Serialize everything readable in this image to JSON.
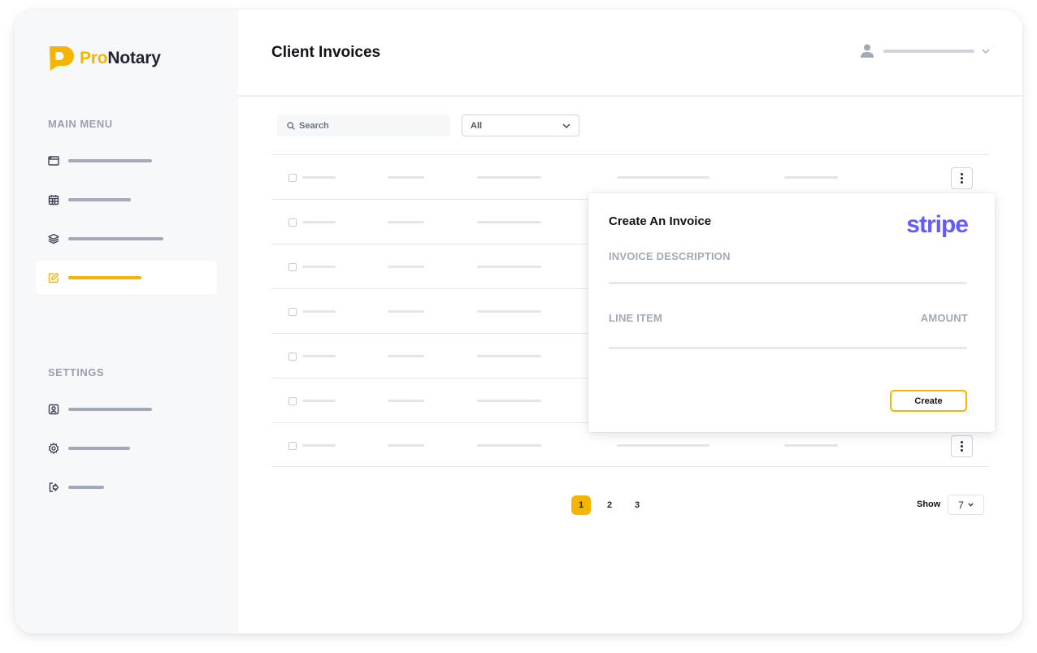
{
  "brand": {
    "name_part1": "Pro",
    "name_part2": "Notary",
    "accent_color": "#f5b400",
    "dark_color": "#1e2433"
  },
  "sidebar": {
    "main_menu_label": "MAIN MENU",
    "settings_label": "SETTINGS",
    "main_items": [
      {
        "icon": "browser-window-icon",
        "active": false
      },
      {
        "icon": "calendar-icon",
        "active": false
      },
      {
        "icon": "layers-icon",
        "active": false
      },
      {
        "icon": "edit-icon",
        "active": true
      }
    ],
    "settings_items": [
      {
        "icon": "profile-icon"
      },
      {
        "icon": "gear-icon"
      },
      {
        "icon": "logout-icon"
      }
    ]
  },
  "header": {
    "title": "Client Invoices",
    "user_icon": "user-icon"
  },
  "toolbar": {
    "search_placeholder": "Search",
    "filter_value": "All"
  },
  "table": {
    "row_count": 7
  },
  "invoice_popup": {
    "title": "Create An Invoice",
    "provider": "stripe",
    "provider_color": "#635bff",
    "description_label": "INVOICE DESCRIPTION",
    "line_item_label": "LINE ITEM",
    "amount_label": "AMOUNT",
    "create_label": "Create"
  },
  "pagination": {
    "pages": [
      "1",
      "2",
      "3"
    ],
    "current": "1",
    "show_label": "Show",
    "show_value": "7"
  }
}
